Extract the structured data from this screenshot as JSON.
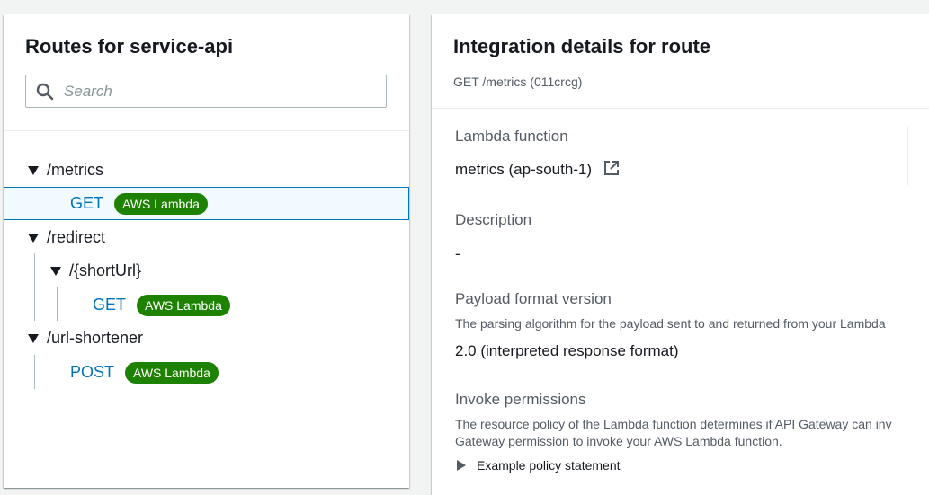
{
  "left": {
    "title": "Routes for service-api",
    "search": {
      "placeholder": "Search",
      "value": ""
    },
    "routes": [
      {
        "path": "/metrics",
        "method": "GET",
        "integration": "AWS Lambda"
      },
      {
        "path": "/redirect",
        "subpath": "/{shortUrl}",
        "method": "GET",
        "integration": "AWS Lambda"
      },
      {
        "path": "/url-shortener",
        "method": "POST",
        "integration": "AWS Lambda"
      }
    ]
  },
  "right": {
    "title": "Integration details for route",
    "subtitle": "GET /metrics (011crcg)",
    "lambda": {
      "key": "Lambda function",
      "value": "metrics (ap-south-1)"
    },
    "description": {
      "key": "Description",
      "value": "-"
    },
    "payload": {
      "key": "Payload format version",
      "desc": "The parsing algorithm for the payload sent to and returned from your Lambda",
      "value": "2.0 (interpreted response format)"
    },
    "invoke": {
      "key": "Invoke permissions",
      "desc_line1": "The resource policy of the Lambda function determines if API Gateway can inv",
      "desc_line2": "Gateway permission to invoke your AWS Lambda function.",
      "expander": "Example policy statement"
    }
  },
  "colors": {
    "badge": "#1d8102",
    "link": "#0073bb",
    "selected_bg": "#f1faff"
  },
  "icons": [
    "search-icon",
    "caret-down-icon",
    "external-link-icon",
    "caret-right-icon"
  ]
}
